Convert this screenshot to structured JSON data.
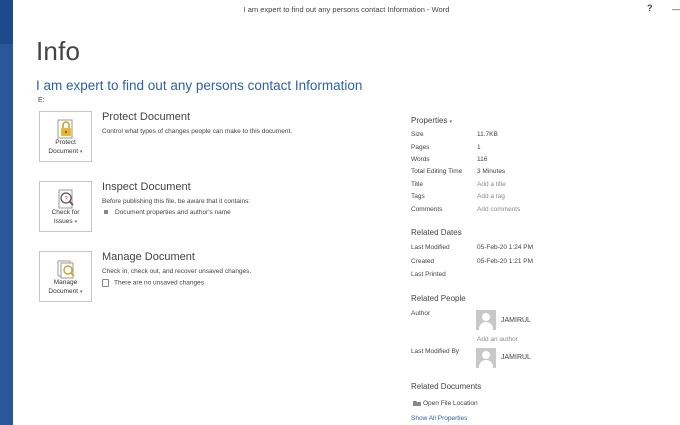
{
  "window": {
    "title": "I am expert to find out any persons contact Information - Word",
    "help_label": "?",
    "minimize_label": "—"
  },
  "page": {
    "heading": "Info",
    "doc_title": "I am expert to find out any persons contact Information",
    "location": "E:"
  },
  "actions": {
    "protect": {
      "tile_label_1": "Protect",
      "tile_label_2": "Document",
      "heading": "Protect Document",
      "description": "Control what types of changes people can make to this document."
    },
    "inspect": {
      "tile_label_1": "Check for",
      "tile_label_2": "Issues",
      "heading": "Inspect Document",
      "description": "Before publishing this file, be aware that it contains:",
      "bullet": "Document properties and author's name"
    },
    "manage": {
      "tile_label_1": "Manage",
      "tile_label_2": "Document",
      "heading": "Manage Document",
      "description": "Check in, check out, and recover unsaved changes.",
      "bullet": "There are no unsaved changes."
    }
  },
  "properties": {
    "heading": "Properties",
    "items": [
      {
        "label": "Size",
        "value": "11.7KB"
      },
      {
        "label": "Pages",
        "value": "1"
      },
      {
        "label": "Words",
        "value": "116"
      },
      {
        "label": "Total Editing Time",
        "value": "3 Minutes"
      },
      {
        "label": "Title",
        "value": "Add a title"
      },
      {
        "label": "Tags",
        "value": "Add a tag"
      },
      {
        "label": "Comments",
        "value": "Add comments"
      }
    ]
  },
  "related_dates": {
    "heading": "Related Dates",
    "items": [
      {
        "label": "Last Modified",
        "value": "05-Feb-20 1:24 PM"
      },
      {
        "label": "Created",
        "value": "05-Feb-20 1:21 PM"
      },
      {
        "label": "Last Printed",
        "value": ""
      }
    ]
  },
  "related_people": {
    "heading": "Related People",
    "author_label": "Author",
    "author_name": "JAMIRUL",
    "add_author": "Add an author",
    "last_modified_by_label": "Last Modified By",
    "last_modified_by_name": "JAMIRUL"
  },
  "related_documents": {
    "heading": "Related Documents",
    "open_location": "Open File Location",
    "show_all": "Show All Properties"
  },
  "icons": {
    "lock": "lock-icon",
    "inspect": "inspect-icon",
    "manage": "manage-icon",
    "avatar": "person-icon",
    "folder": "folder-icon"
  },
  "colors": {
    "sidebar": "#2b579a",
    "link": "#2e62a8"
  }
}
